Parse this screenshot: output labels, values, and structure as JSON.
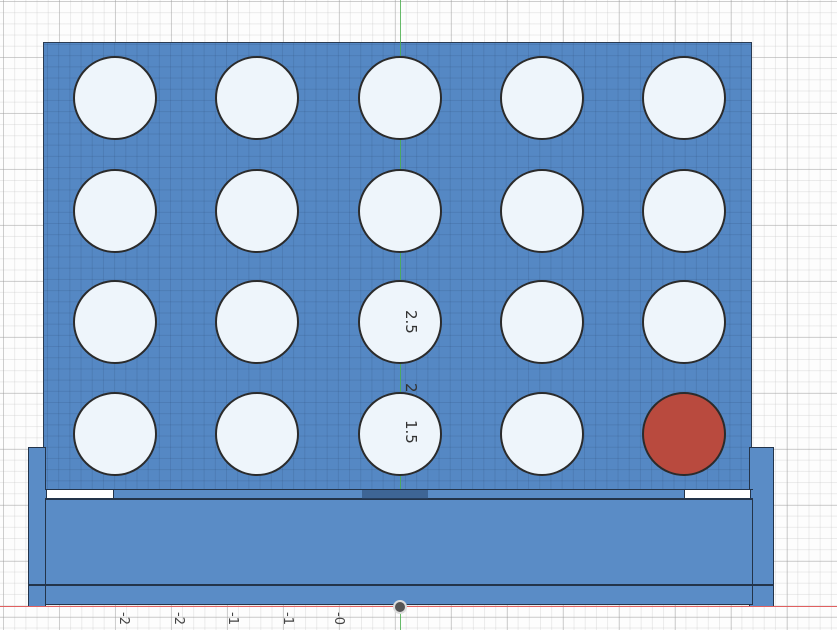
{
  "scene": {
    "board": {
      "rows": 4,
      "cols": 5,
      "piece_positions": [
        "row4-col5"
      ],
      "colors": {
        "panel": "#5588c4",
        "hole": "#eef5fb",
        "piece": "#b94a3e",
        "outline": "#2b2b2b"
      }
    }
  },
  "axes": {
    "vertical_axis_color": "#4caf50",
    "horizontal_axis_color": "#e06060"
  },
  "dimension_labels": {
    "v1": "2.5",
    "v2": "2",
    "v3": "1.5"
  },
  "ruler_labels": [
    "-2",
    "-2",
    "-1",
    "-1",
    "-0"
  ]
}
